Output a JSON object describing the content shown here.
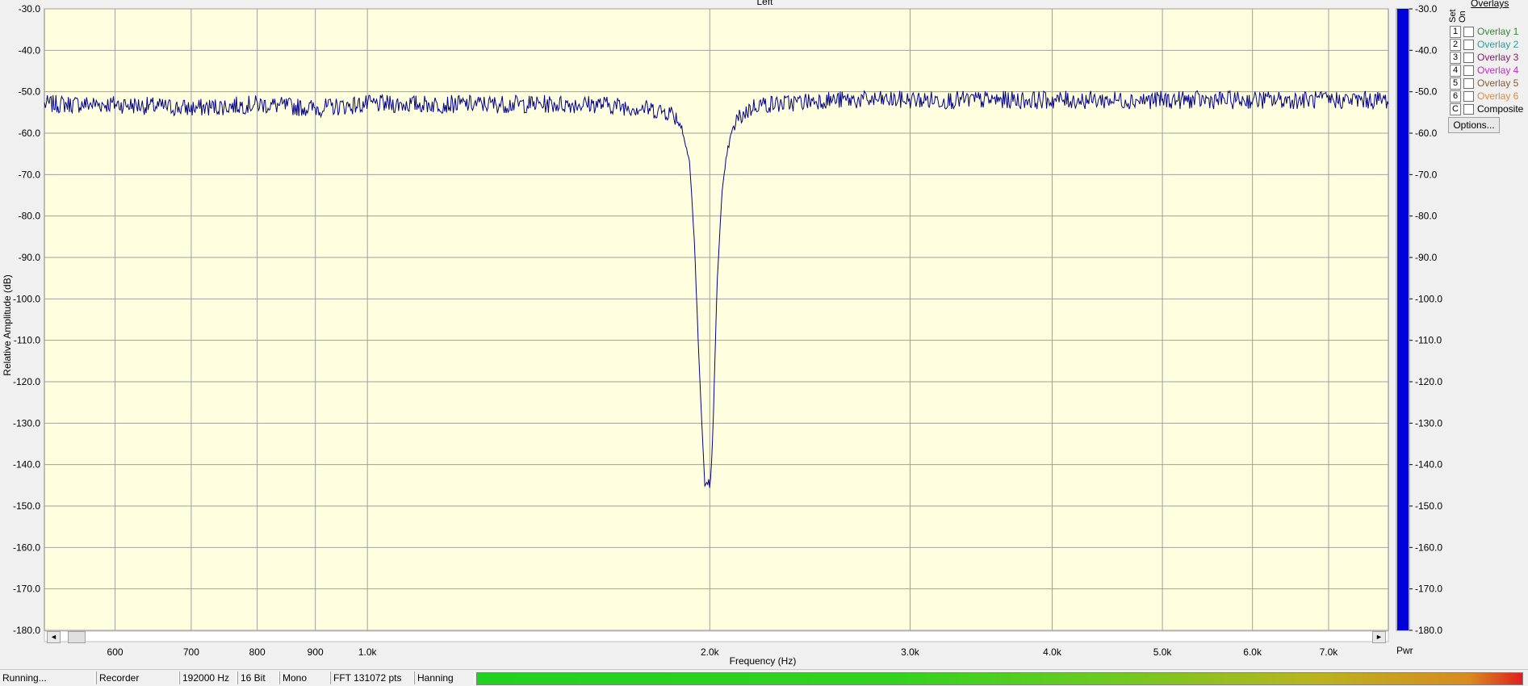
{
  "chart_data": {
    "type": "line",
    "title": "Left",
    "xlabel": "Frequency (Hz)",
    "ylabel": "Relative Amplitude (dB)",
    "x_scale": "log",
    "xlim": [
      520,
      7900
    ],
    "ylim": [
      -180,
      -30
    ],
    "grid": true,
    "x_ticks": [
      600,
      700,
      800,
      900,
      1000,
      2000,
      3000,
      4000,
      5000,
      6000,
      7000
    ],
    "x_tick_labels": [
      "600",
      "700",
      "800",
      "900",
      "1.0k",
      "2.0k",
      "3.0k",
      "4.0k",
      "5.0k",
      "6.0k",
      "7.0k"
    ],
    "y_ticks": [
      -30,
      -40,
      -50,
      -60,
      -70,
      -80,
      -90,
      -100,
      -110,
      -120,
      -130,
      -140,
      -150,
      -160,
      -170,
      -180
    ],
    "y_tick_labels": [
      "-30.0",
      "-40.0",
      "-50.0",
      "-60.0",
      "-70.0",
      "-80.0",
      "-90.0",
      "-100.0",
      "-110.0",
      "-120.0",
      "-130.0",
      "-140.0",
      "-150.0",
      "-160.0",
      "-170.0",
      "-180.0"
    ],
    "series": [
      {
        "color": "#00008b",
        "x": [
          520,
          600,
          700,
          800,
          900,
          1000,
          1200,
          1400,
          1600,
          1750,
          1850,
          1880,
          1900,
          1920,
          1940,
          1960,
          1980,
          1995,
          2000,
          2005,
          2015,
          2030,
          2050,
          2070,
          2090,
          2110,
          2150,
          2200,
          2300,
          2500,
          3000,
          4000,
          5000,
          6000,
          7000,
          7900
        ],
        "y": [
          -53,
          -53,
          -54,
          -53,
          -54,
          -53,
          -53,
          -53,
          -53,
          -54,
          -55,
          -57,
          -61,
          -67,
          -88,
          -120,
          -145,
          -144,
          -145,
          -143,
          -128,
          -95,
          -75,
          -65,
          -60,
          -57,
          -55,
          -53,
          -53,
          -52,
          -52,
          -52,
          -52,
          -52,
          -52,
          -52
        ]
      }
    ]
  },
  "pwr_meter": {
    "label": "Pwr",
    "level": 1.0,
    "color": "#0000dd",
    "tick_labels": [
      "-30.0",
      "-40.0",
      "-50.0",
      "-60.0",
      "-70.0",
      "-80.0",
      "-90.0",
      "-100.0",
      "-110.0",
      "-120.0",
      "-130.0",
      "-140.0",
      "-150.0",
      "-160.0",
      "-170.0",
      "-180.0"
    ]
  },
  "overlays": {
    "title": "Overlays",
    "set_header": "Set",
    "on_header": "On",
    "items": [
      {
        "set": "1",
        "label": "Overlay 1",
        "color": "#2e8b2e"
      },
      {
        "set": "2",
        "label": "Overlay 2",
        "color": "#22a0a0"
      },
      {
        "set": "3",
        "label": "Overlay 3",
        "color": "#8b1a6b"
      },
      {
        "set": "4",
        "label": "Overlay 4",
        "color": "#cc22cc"
      },
      {
        "set": "5",
        "label": "Overlay 5",
        "color": "#8b5a2b"
      },
      {
        "set": "6",
        "label": "Overlay 6",
        "color": "#e08a3a"
      },
      {
        "set": "C",
        "label": "Composite",
        "color": "#000000"
      }
    ],
    "options_label": "Options..."
  },
  "status_bar": {
    "state": "Running...",
    "source": "Recorder",
    "sample_rate": "192000 Hz",
    "bit_depth": "16 Bit",
    "channels": "Mono",
    "fft_size": "FFT 131072 pts",
    "window": "Hanning"
  },
  "scroll": {
    "left_arrow": "◄",
    "right_arrow": "►"
  }
}
